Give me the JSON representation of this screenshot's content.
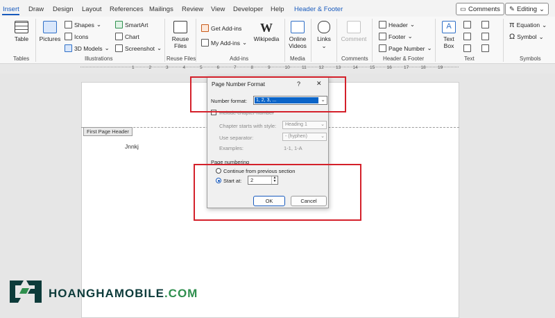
{
  "tabs": [
    "Insert",
    "Draw",
    "Design",
    "Layout",
    "References",
    "Mailings",
    "Review",
    "View",
    "Developer",
    "Help",
    "Header & Footer"
  ],
  "top_buttons": {
    "comments": "Comments",
    "editing": "Editing"
  },
  "ribbon": {
    "tables": {
      "table": "Table",
      "label": "Tables"
    },
    "illustrations": {
      "pictures": "Pictures",
      "shapes": "Shapes",
      "icons": "Icons",
      "models": "3D Models",
      "smartart": "SmartArt",
      "chart": "Chart",
      "screenshot": "Screenshot",
      "label": "Illustrations"
    },
    "reuse": {
      "button": "Reuse Files",
      "label": "Reuse Files"
    },
    "addins": {
      "get": "Get Add-ins",
      "my": "My Add-ins",
      "wikipedia": "Wikipedia",
      "label": "Add-ins"
    },
    "media": {
      "online_videos": "Online Videos",
      "label": "Media"
    },
    "links": {
      "button": "Links"
    },
    "comments": {
      "button": "Comment",
      "label": "Comments"
    },
    "header_footer": {
      "header": "Header",
      "footer": "Footer",
      "page_number": "Page Number",
      "label": "Header & Footer"
    },
    "text": {
      "text_box": "Text Box",
      "label": "Text"
    },
    "symbols": {
      "equation": "Equation",
      "symbol": "Symbol",
      "label": "Symbols"
    }
  },
  "ruler_numbers": [
    "1",
    "2",
    "3",
    "4",
    "5",
    "6",
    "7",
    "8",
    "9",
    "10",
    "11",
    "12",
    "13",
    "14",
    "15",
    "16",
    "17",
    "18",
    "19"
  ],
  "document": {
    "header_tag": "First Page Header",
    "text": "Jnnkj"
  },
  "dialog": {
    "title": "Page Number Format",
    "help": "?",
    "close": "✕",
    "number_format_label": "Number format:",
    "number_format_value": "1, 2, 3, ...",
    "include_chapter": "Include chapter number",
    "chapter_style_label": "Chapter starts with style:",
    "chapter_style_value": "Heading 1",
    "separator_label": "Use separator:",
    "separator_value": "-  (hyphen)",
    "examples_label": "Examples:",
    "examples_value": "1-1, 1-A",
    "page_numbering": "Page numbering",
    "continue": "Continue from previous section",
    "start_at": "Start at:",
    "start_value": "2",
    "ok": "OK",
    "cancel": "Cancel"
  },
  "brand": "HOANGHAMOBILE.COM",
  "colors": {
    "accent": "#185abd",
    "highlight": "#d4202a",
    "brand_dark": "#0d3b3a",
    "brand_green": "#2f8f4e"
  }
}
